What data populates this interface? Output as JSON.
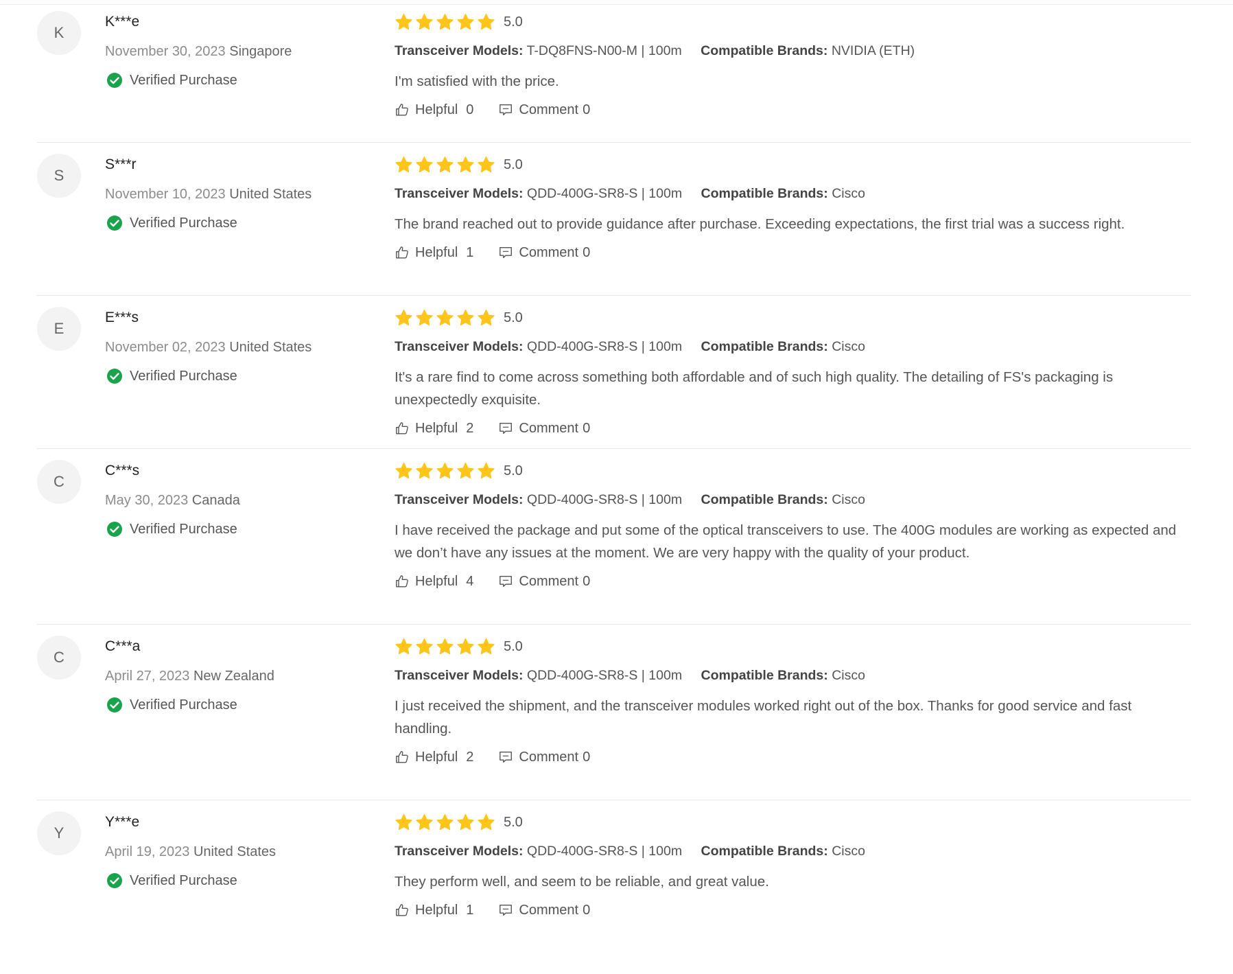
{
  "labels": {
    "verified": "Verified Purchase",
    "models": "Transceiver Models:",
    "brands": "Compatible Brands:",
    "helpful": "Helpful",
    "comment": "Comment"
  },
  "colors": {
    "star": "#ffc51b",
    "verified": "#19a34a",
    "divider": "#e6e6e6"
  },
  "reviews": [
    {
      "initial": "K",
      "name": "K***e",
      "date": "November 30, 2023",
      "country": "Singapore",
      "stars": 5,
      "score": "5.0",
      "model": "T-DQ8FNS-N00-M | 100m",
      "brand": "NVIDIA (ETH)",
      "text": "I'm satisfied with the price.",
      "helpful": "0",
      "comments": "0"
    },
    {
      "initial": "S",
      "name": "S***r",
      "date": "November 10, 2023",
      "country": "United States",
      "stars": 5,
      "score": "5.0",
      "model": "QDD-400G-SR8-S | 100m",
      "brand": "Cisco",
      "text": "The brand reached out to provide guidance after purchase. Exceeding expectations, the first trial was a success right.",
      "helpful": "1",
      "comments": "0"
    },
    {
      "initial": "E",
      "name": "E***s",
      "date": "November 02, 2023",
      "country": "United States",
      "stars": 5,
      "score": "5.0",
      "model": "QDD-400G-SR8-S | 100m",
      "brand": "Cisco",
      "text": "It's a rare find to come across something both affordable and of such high quality. The detailing of FS's packaging is unexpectedly exquisite.",
      "helpful": "2",
      "comments": "0"
    },
    {
      "initial": "C",
      "name": "C***s",
      "date": "May 30, 2023",
      "country": "Canada",
      "stars": 5,
      "score": "5.0",
      "model": "QDD-400G-SR8-S | 100m",
      "brand": "Cisco",
      "text": "I have received the package and put some of the optical transceivers to use. The 400G modules are working as expected and we don’t have any issues at the moment. We are very happy with the quality of your product.",
      "helpful": "4",
      "comments": "0"
    },
    {
      "initial": "C",
      "name": "C***a",
      "date": "April 27, 2023",
      "country": "New Zealand",
      "stars": 5,
      "score": "5.0",
      "model": "QDD-400G-SR8-S | 100m",
      "brand": "Cisco",
      "text": "I just received the shipment, and the transceiver modules worked right out of the box. Thanks for good service and fast handling.",
      "helpful": "2",
      "comments": "0"
    },
    {
      "initial": "Y",
      "name": "Y***e",
      "date": "April 19, 2023",
      "country": "United States",
      "stars": 5,
      "score": "5.0",
      "model": "QDD-400G-SR8-S | 100m",
      "brand": "Cisco",
      "text": "They perform well, and seem to be reliable, and great value.",
      "helpful": "1",
      "comments": "0"
    }
  ]
}
